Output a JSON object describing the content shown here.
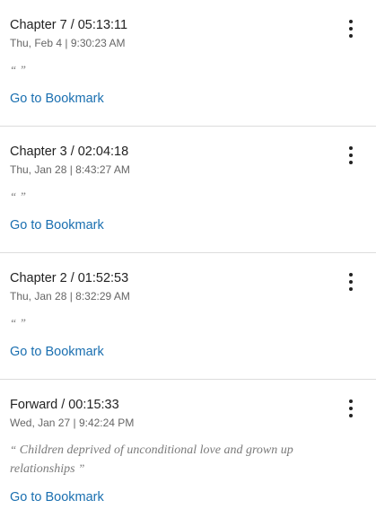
{
  "bookmarks": [
    {
      "chapter": "Chapter 7",
      "separator": "/",
      "time": "05:13:11",
      "date": "Thu, Feb 4 | 9:30:23 AM",
      "quote_open": "“",
      "quote_text": "",
      "quote_close": "”",
      "link_label": "Go to Bookmark",
      "menu_icon": "more-vertical-icon"
    },
    {
      "chapter": "Chapter 3",
      "separator": "/",
      "time": "02:04:18",
      "date": "Thu, Jan 28 | 8:43:27 AM",
      "quote_open": "“",
      "quote_text": "",
      "quote_close": "”",
      "link_label": "Go to Bookmark",
      "menu_icon": "more-vertical-icon"
    },
    {
      "chapter": "Chapter 2",
      "separator": "/",
      "time": "01:52:53",
      "date": "Thu, Jan 28 | 8:32:29 AM",
      "quote_open": "“",
      "quote_text": "",
      "quote_close": "”",
      "link_label": "Go to Bookmark",
      "menu_icon": "more-vertical-icon"
    },
    {
      "chapter": "Forward",
      "separator": "/",
      "time": "00:15:33",
      "date": "Wed, Jan 27 | 9:42:24 PM",
      "quote_open": "“",
      "quote_text": "Children deprived of unconditional love and grown up relationships",
      "quote_close": "”",
      "link_label": "Go to Bookmark",
      "menu_icon": "more-vertical-icon"
    }
  ],
  "colors": {
    "link": "#1a6fb0",
    "text": "#222222",
    "meta": "#666666",
    "quote": "#7a7a7a",
    "divider": "#dcdcdc"
  }
}
